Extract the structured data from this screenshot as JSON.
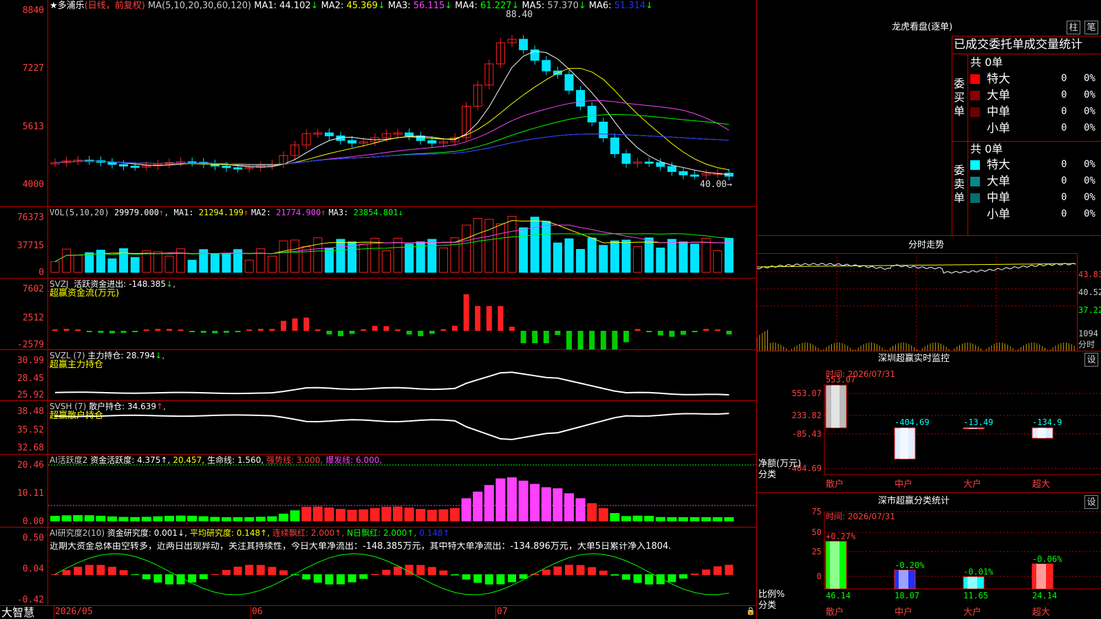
{
  "colors": {
    "up": "#ff2020",
    "down": "#00e5ff",
    "ma1": "#ffffff",
    "ma2": "#ffff00",
    "ma3": "#ff40ff",
    "ma4": "#00ff00",
    "ma5": "#c0c0c0",
    "ma6": "#2030ff",
    "border": "#c00000"
  },
  "main": {
    "stock_name": "★多浦乐",
    "period": "(日线，前复权)",
    "ma_params": "MA(5,10,20,30,60,120)",
    "ma": [
      {
        "label": "MA1:",
        "value": "44.102",
        "arrow": "↓"
      },
      {
        "label": "MA2:",
        "value": "45.369",
        "arrow": "↓"
      },
      {
        "label": "MA3:",
        "value": "56.115",
        "arrow": "↓"
      },
      {
        "label": "MA4:",
        "value": "61.227",
        "arrow": "↓"
      },
      {
        "label": "MA5:",
        "value": "57.370",
        "arrow": "↓"
      },
      {
        "label": "MA6:",
        "value": "51.314",
        "arrow": "↓"
      }
    ],
    "y_labels": [
      "8840",
      "7227",
      "5613",
      "4000"
    ],
    "high_label": "88.40",
    "low_label": "40.00"
  },
  "vol": {
    "title": "VOL(5,10,20)",
    "value": "29979.000",
    "ma": [
      {
        "label": "MA1:",
        "value": "21294.199",
        "arrow": "↑"
      },
      {
        "label": "MA2:",
        "value": "21774.900",
        "arrow": "↑"
      },
      {
        "label": "MA3:",
        "value": "23854.801",
        "arrow": "↓"
      }
    ],
    "y_labels": [
      "76373",
      "37715",
      "0"
    ]
  },
  "svzj": {
    "title": "SVZJ",
    "label": "活跃资金进出:",
    "value": "-148.385",
    "arrow": "↓",
    "sub": "超赢资金流(万元)",
    "y_labels": [
      "7602",
      "2512",
      "-2579"
    ]
  },
  "svzl": {
    "title": "SVZL (7)",
    "label": "主力持仓:",
    "value": "28.794",
    "arrow": "↓",
    "sub": "超赢主力持仓",
    "y_labels": [
      "30.99",
      "28.45",
      "25.92"
    ]
  },
  "svsh": {
    "title": "SVSH (7)",
    "label": "散户持仓:",
    "value": "34.639",
    "arrow": "↑",
    "sub": "超赢散户持仓",
    "y_labels": [
      "38.48",
      "35.52",
      "32.68"
    ]
  },
  "ai1": {
    "title": "AI活跃度2",
    "items": [
      {
        "text": "资金活跃度: 4.375↑,",
        "color": "#ffffff"
      },
      {
        "text": "20.457,",
        "color": "#ffff00"
      },
      {
        "text": "生命线: 1.560,",
        "color": "#ffffff"
      },
      {
        "text": "强势线: 3.000,",
        "color": "#ff4040"
      },
      {
        "text": "爆发线: 6.000,",
        "color": "#ff40ff"
      }
    ],
    "y_labels": [
      "20.46",
      "10.11",
      "0.00"
    ]
  },
  "ai2": {
    "title": "AI研究度2(10)",
    "items": [
      {
        "text": "资金研究度: 0.001↓,",
        "color": "#ffffff"
      },
      {
        "text": "平均研究度: 0.148↑,",
        "color": "#ffff00"
      },
      {
        "text": "连续飘红: 2.000↑,",
        "color": "#ff4040"
      },
      {
        "text": "N日飘红: 2.000↑,",
        "color": "#00ff00"
      },
      {
        "text": "0.148↑",
        "color": "#2030ff"
      }
    ],
    "comment": "近期大资金总体由空转多，近两日出现异动，关注其持续性，今日大单净流出：-148.385万元，其中特大单净流出：-134.896万元，大单5日累计净入1804.",
    "y_labels": [
      "0.50",
      "0.04",
      "-0.42"
    ]
  },
  "footer": {
    "brand": "大智慧",
    "dates": [
      "2026/05",
      "06",
      "07"
    ]
  },
  "lhb": {
    "title": "龙虎看盘(逐单)",
    "btn1": "柱",
    "btn2": "笔",
    "header": "已成交委托单成交量统计",
    "buy_side": "委买单",
    "sell_side": "委卖单",
    "buy_total": "共 0单",
    "sell_total": "共 0单",
    "buy_rows": [
      {
        "name": "特大",
        "count": "0",
        "pct": "0%",
        "color": "#ff0000"
      },
      {
        "name": "大单",
        "count": "0",
        "pct": "0%",
        "color": "#8b0000"
      },
      {
        "name": "中单",
        "count": "0",
        "pct": "0%",
        "color": "#6b0000"
      },
      {
        "name": "小单",
        "count": "0",
        "pct": "0%",
        "color": ""
      }
    ],
    "sell_rows": [
      {
        "name": "特大",
        "count": "0",
        "pct": "0%",
        "color": "#00ffff"
      },
      {
        "name": "大单",
        "count": "0",
        "pct": "0%",
        "color": "#008b8b"
      },
      {
        "name": "中单",
        "count": "0",
        "pct": "0%",
        "color": "#007070"
      },
      {
        "name": "小单",
        "count": "0",
        "pct": "0%",
        "color": ""
      }
    ]
  },
  "fenshi": {
    "title": "分时走势",
    "y_labels": [
      "43.83",
      "40.52",
      "37.22"
    ],
    "vol_label": "1094",
    "vol_unit": "分时"
  },
  "szjk": {
    "title": "深圳超赢实时监控",
    "btn": "设",
    "time": "时间: 2026/07/31",
    "y_labels": [
      "553.07",
      "233.82",
      "-85.43",
      "-404.69"
    ],
    "unit_label": "净额(万元)",
    "cat_label": "分类",
    "bars": [
      {
        "name": "散户",
        "value": 553.07,
        "label": "553.07"
      },
      {
        "name": "中户",
        "value": -404.69,
        "label": "-404.69"
      },
      {
        "name": "大户",
        "value": -13.49,
        "label": "-13.49"
      },
      {
        "name": "超大",
        "value": -134.9,
        "label": "-134.9"
      }
    ]
  },
  "smfl": {
    "title": "深市超赢分类统计",
    "btn": "设",
    "time": "时间: 2026/07/31",
    "y_labels": [
      "75",
      "50",
      "25",
      "0"
    ],
    "unit_label": "比例%",
    "cat_label": "分类",
    "bars": [
      {
        "name": "散户",
        "value": 46.14,
        "label": "46.14",
        "delta": "+0.27%"
      },
      {
        "name": "中户",
        "value": 18.07,
        "label": "18.07",
        "delta": "-0.20%"
      },
      {
        "name": "大户",
        "value": 11.65,
        "label": "11.65",
        "delta": "-0.01%"
      },
      {
        "name": "超大",
        "value": 24.14,
        "label": "24.14",
        "delta": "-0.06%"
      }
    ]
  }
}
